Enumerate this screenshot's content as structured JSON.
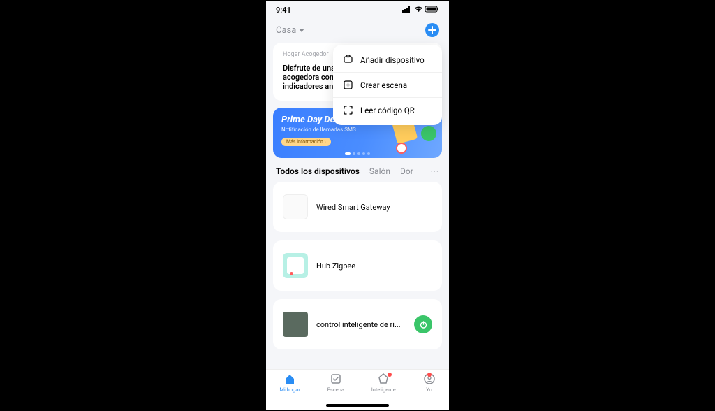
{
  "status": {
    "time": "9:41"
  },
  "header": {
    "home_label": "Casa"
  },
  "dropdown": {
    "items": [
      {
        "label": "Añadir dispositivo"
      },
      {
        "label": "Crear escena"
      },
      {
        "label": "Leer código QR"
      }
    ]
  },
  "cozy": {
    "eyebrow": "Hogar Acogedor",
    "line1": "Disfrute de una",
    "line2": "acogedora con",
    "line3": "indicadores an"
  },
  "promo": {
    "title": "Prime Day Deals",
    "subtitle": "Notificación de llamadas SMS",
    "cta": "Más información ›"
  },
  "tabs": {
    "items": [
      {
        "label": "Todos los dispositivos"
      },
      {
        "label": "Salón"
      },
      {
        "label": "Dor"
      }
    ],
    "more": "···"
  },
  "devices": [
    {
      "name": "Wired Smart Gateway"
    },
    {
      "name": "Hub Zigbee"
    },
    {
      "name": "control inteligente de ri..."
    }
  ],
  "nav": {
    "items": [
      {
        "label": "Mi hogar"
      },
      {
        "label": "Escena"
      },
      {
        "label": "Inteligente"
      },
      {
        "label": "Yo"
      }
    ]
  }
}
